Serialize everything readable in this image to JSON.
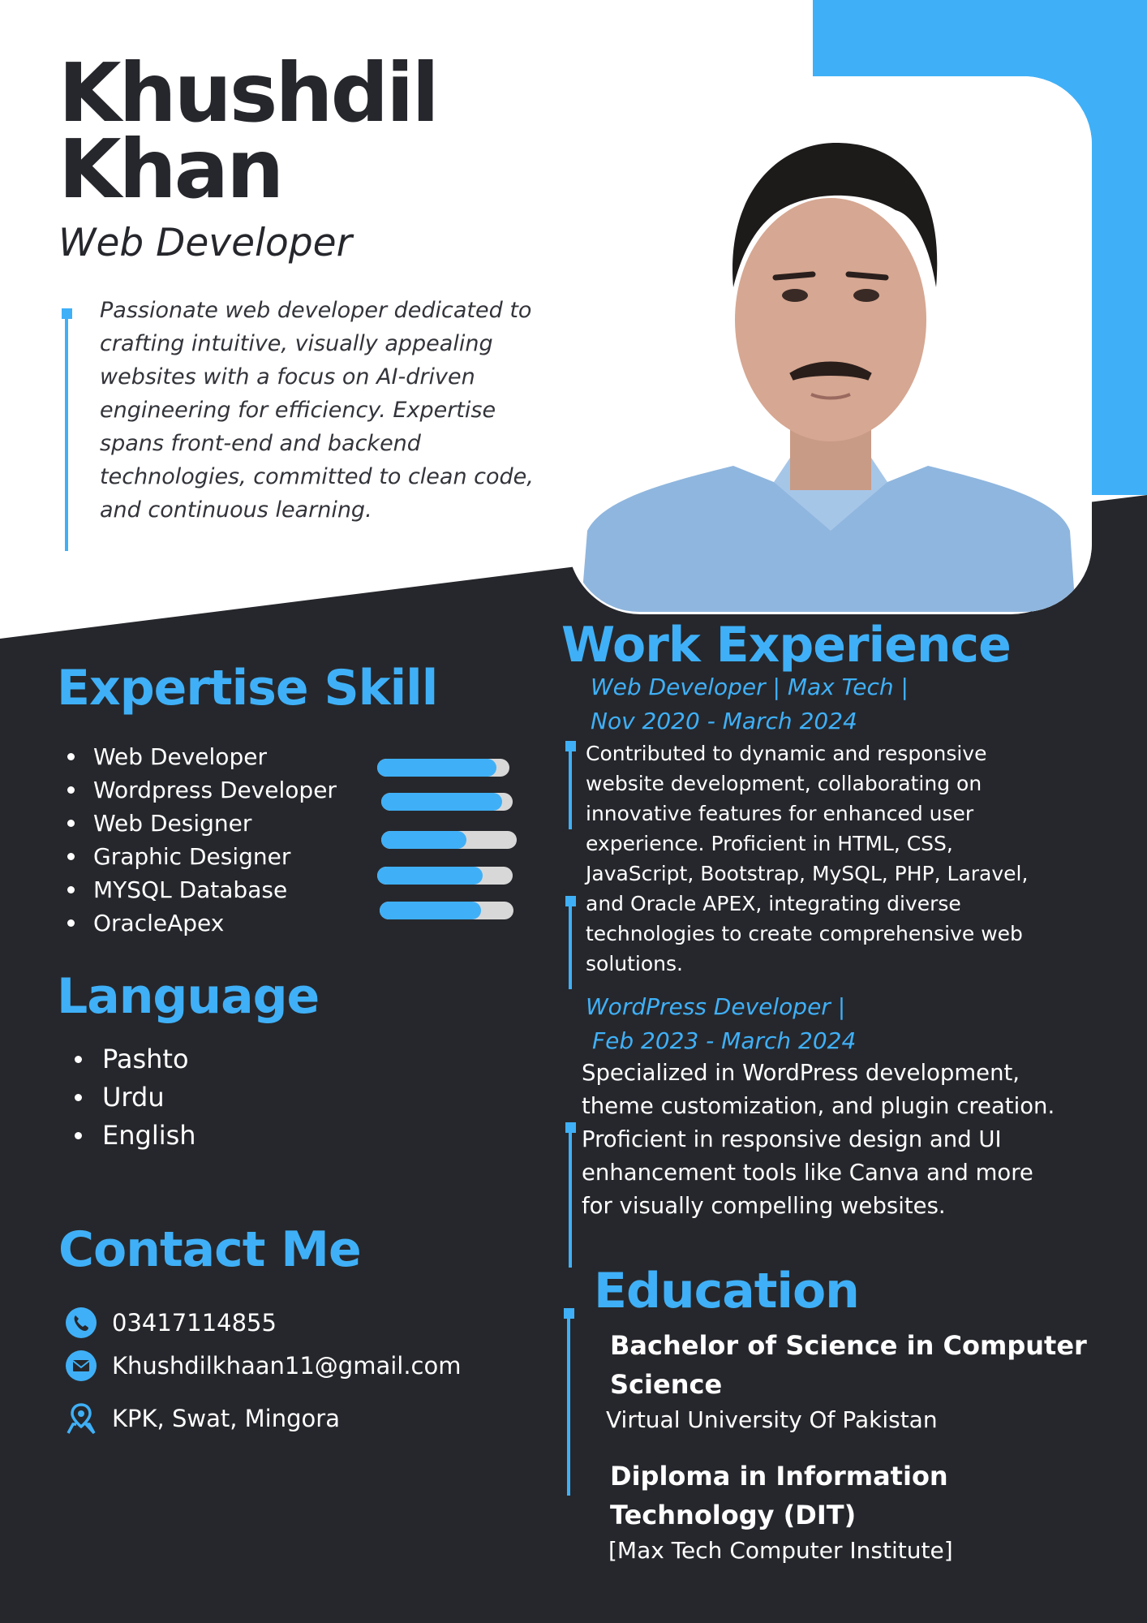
{
  "header": {
    "first_name": "Khushdil",
    "last_name": "Khan",
    "role": "Web Developer",
    "summary": "Passionate web developer dedicated to crafting intuitive, visually appealing websites with a focus on AI-driven engineering for efficiency. Expertise spans front-end and backend technologies, committed to clean code, and continuous learning."
  },
  "skills": {
    "heading": "Expertise Skill",
    "items": [
      {
        "label": "Web Developer",
        "level": 0.9
      },
      {
        "label": "Wordpress Developer",
        "level": 0.92
      },
      {
        "label": "Web Designer",
        "level": 0.63
      },
      {
        "label": "Graphic Designer",
        "level": 0.78
      },
      {
        "label": "MYSQL Database",
        "level": 0.76
      },
      {
        "label": "OracleApex",
        "level": 0.76
      }
    ]
  },
  "languages": {
    "heading": "Language",
    "items": [
      "Pashto",
      "Urdu",
      "English"
    ]
  },
  "contact": {
    "heading": "Contact Me",
    "phone": "03417114855",
    "email": "Khushdilkhaan11@gmail.com",
    "location": "KPK, Swat, Mingora",
    "icons": [
      "phone-icon",
      "email-icon",
      "location-icon"
    ]
  },
  "experience": {
    "heading": "Work Experience",
    "jobs": [
      {
        "title_line1": "Web Developer | Max Tech |",
        "title_line2": "Nov 2020 - March 2024",
        "description": "Contributed to dynamic and responsive website development, collaborating on innovative features for enhanced user experience. Proficient in HTML, CSS, JavaScript, Bootstrap, MySQL, PHP, Laravel, and Oracle APEX, integrating diverse technologies to create comprehensive web solutions."
      },
      {
        "title_line1": "WordPress Developer |",
        "title_line2": "Feb 2023 - March 2024",
        "description": "Specialized in WordPress development, theme customization, and plugin creation. Proficient in responsive design and UI enhancement tools like Canva and more for visually compelling websites."
      }
    ]
  },
  "education": {
    "heading": "Education",
    "items": [
      {
        "degree": "Bachelor of Science in Computer Science",
        "institution": "Virtual University Of Pakistan"
      },
      {
        "degree": "Diploma in Information Technology (DIT)",
        "institution": "[Max Tech Computer Institute]"
      }
    ]
  },
  "colors": {
    "accent": "#3fb0f7",
    "dark": "#26272c",
    "light": "#ffffff"
  }
}
